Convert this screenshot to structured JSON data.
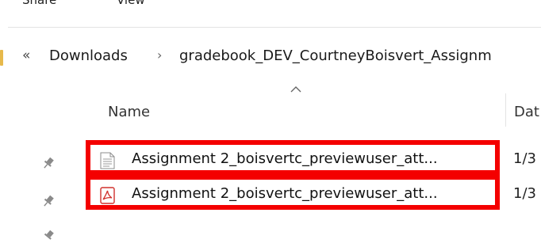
{
  "ribbon": {
    "tabs": [
      "Share",
      "View"
    ]
  },
  "address_bar": {
    "overflow_glyph": "«",
    "separator_glyph": "›",
    "crumbs": [
      "Downloads",
      "gradebook_DEV_CourtneyBoisvert_Assignm"
    ]
  },
  "file_list": {
    "columns": {
      "name": "Name",
      "date": "Dat"
    },
    "sort": "name-ascending",
    "rows": [
      {
        "name": "Assignment 2_boisvertc_previewuser_att...",
        "date": "1/3",
        "icon": "text-file-icon",
        "highlighted": true
      },
      {
        "name": "Assignment 2_boisvertc_previewuser_att...",
        "date": "1/3",
        "icon": "pdf-file-icon",
        "highlighted": true
      }
    ]
  },
  "colors": {
    "highlight": "#f40000",
    "pdf_accent": "#d0312d",
    "folder": "#e7b94b"
  }
}
